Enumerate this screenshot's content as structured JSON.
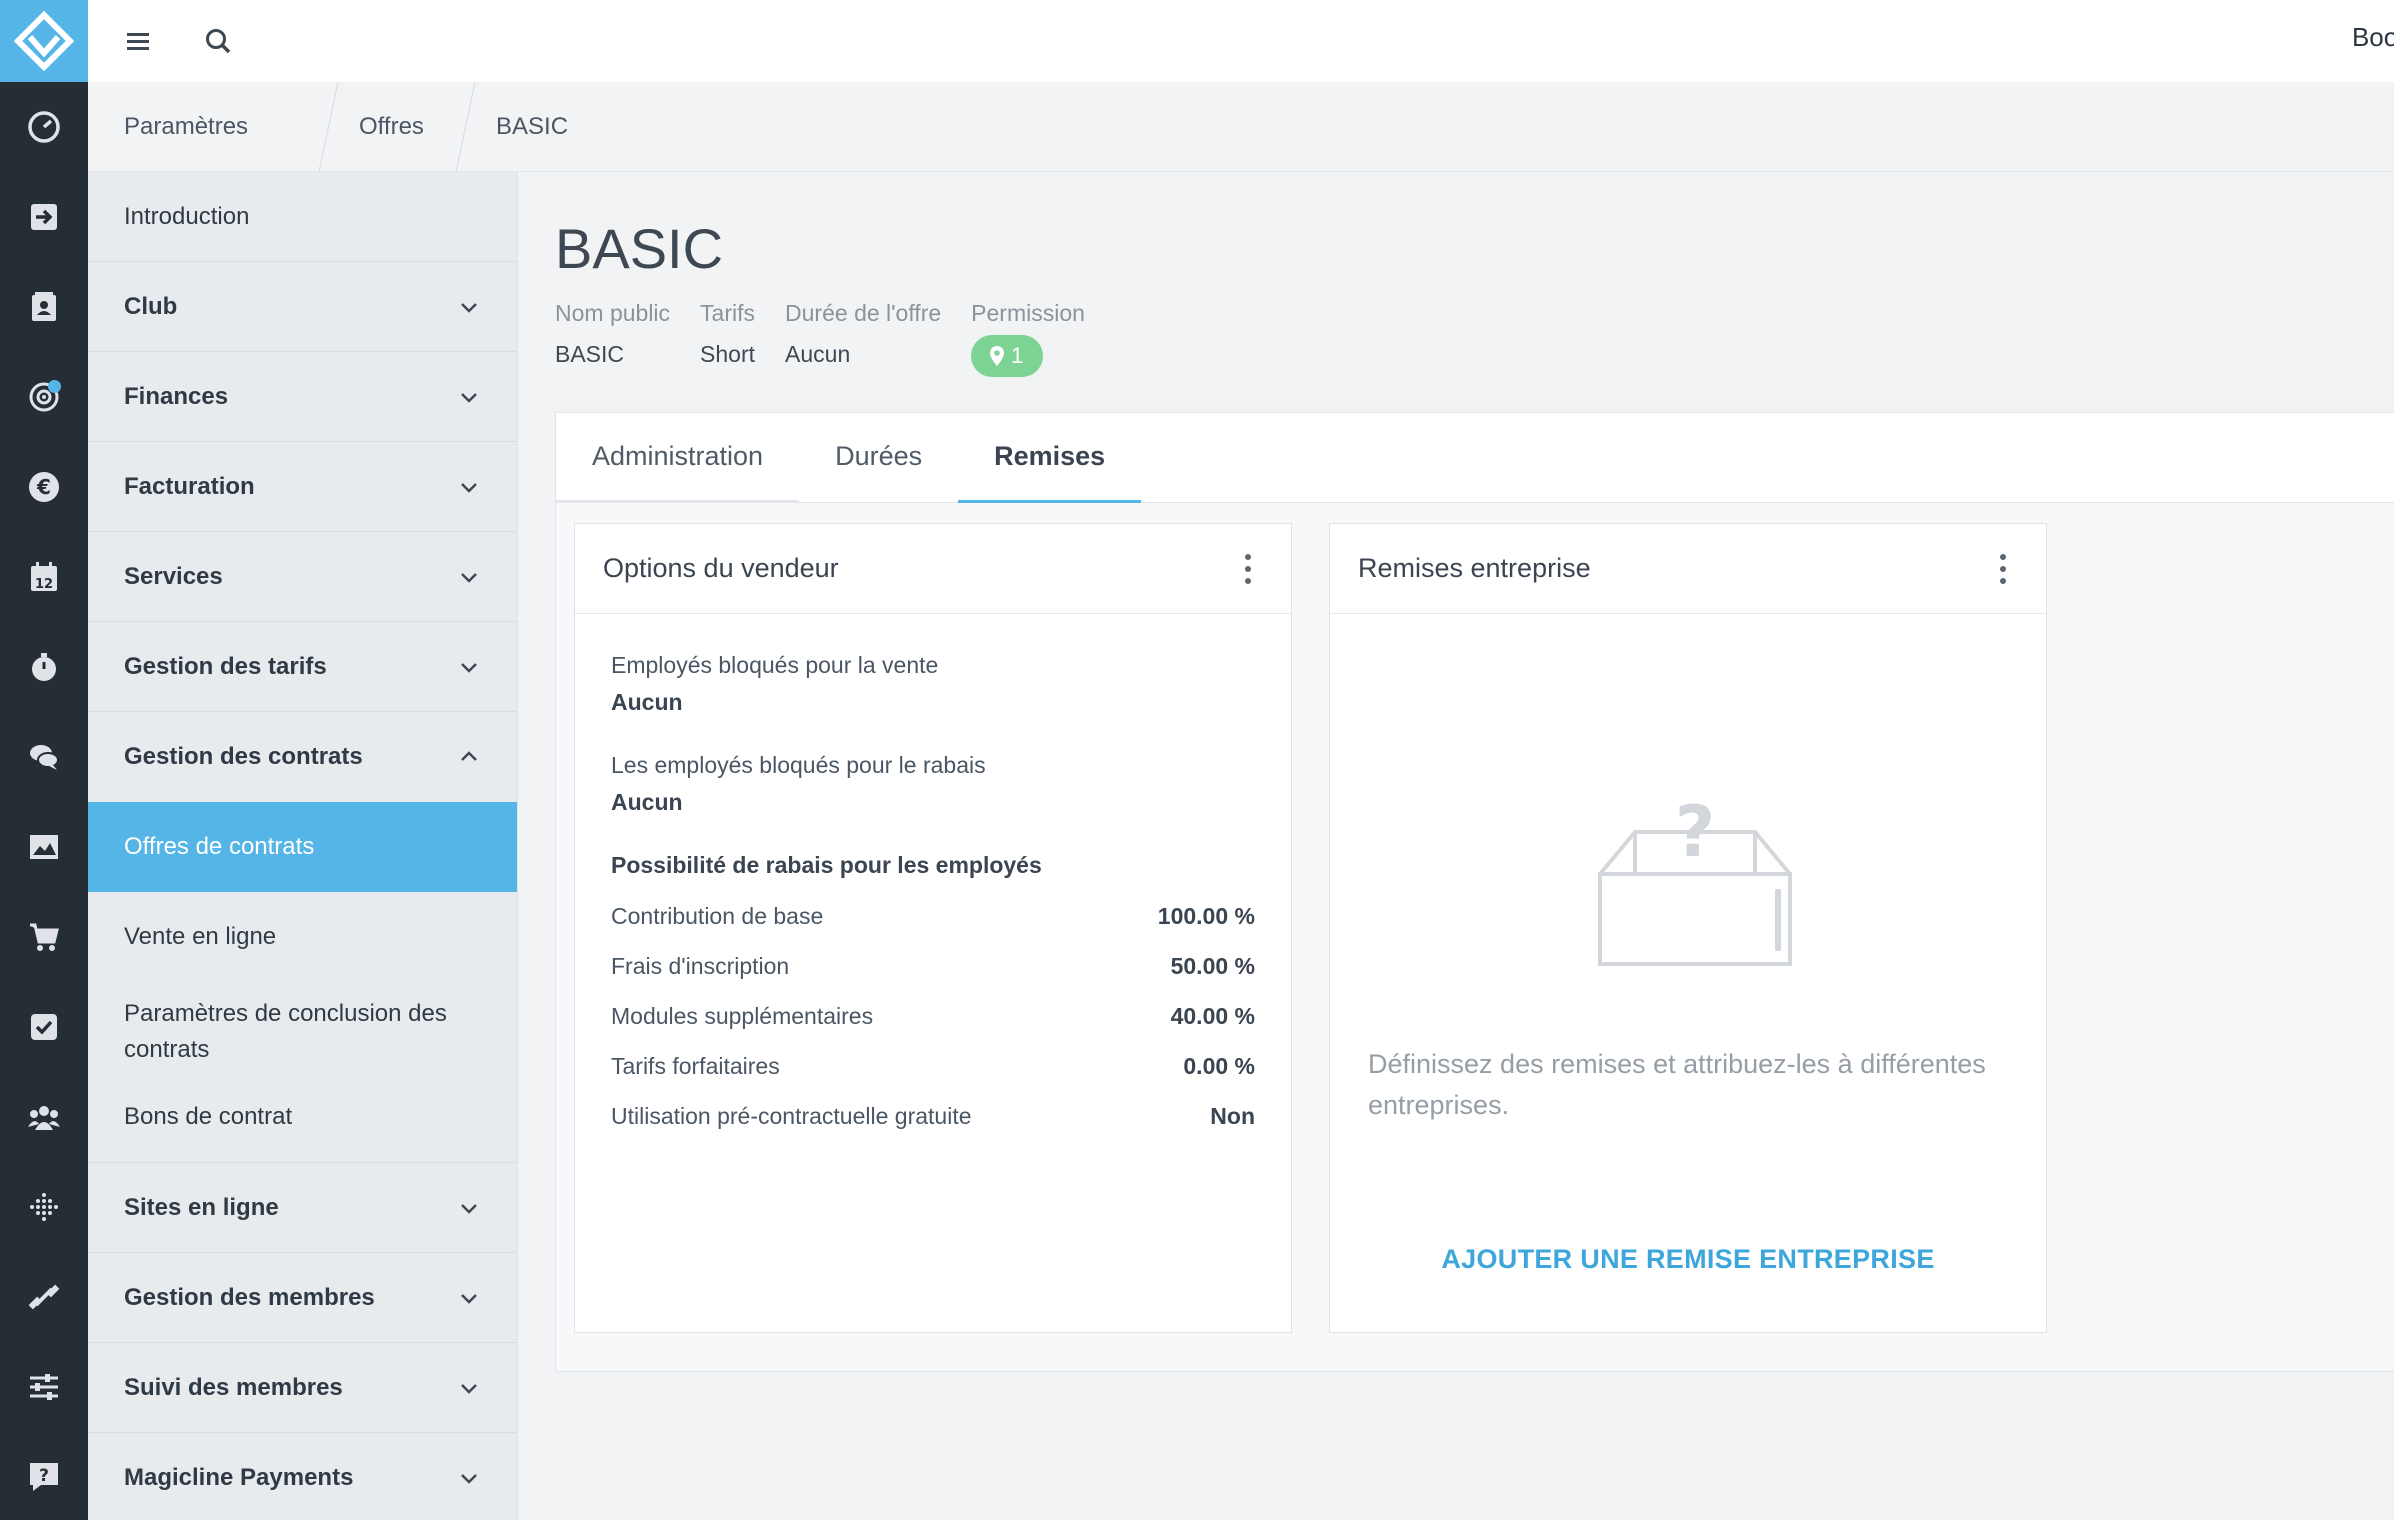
{
  "topbar": {
    "right_text": "Bool"
  },
  "breadcrumb": [
    "Paramètres",
    "Offres",
    "BASIC"
  ],
  "sidebar": {
    "items": [
      {
        "label": "Introduction"
      },
      {
        "label": "Club"
      },
      {
        "label": "Finances"
      },
      {
        "label": "Facturation"
      },
      {
        "label": "Services"
      },
      {
        "label": "Gestion des tarifs"
      },
      {
        "label": "Gestion des contrats"
      },
      {
        "label": "Sites en ligne"
      },
      {
        "label": "Gestion des membres"
      },
      {
        "label": "Suivi des membres"
      },
      {
        "label": "Magicline Payments"
      }
    ],
    "contracts_sub": [
      {
        "label": "Offres de contrats"
      },
      {
        "label": "Vente en ligne"
      },
      {
        "label": "Paramètres de conclusion des contrats"
      },
      {
        "label": "Bons de contrat"
      }
    ]
  },
  "page": {
    "title": "BASIC",
    "meta": [
      {
        "key": "Nom public",
        "value": "BASIC"
      },
      {
        "key": "Tarifs",
        "value": "Short"
      },
      {
        "key": "Durée de l'offre",
        "value": "Aucun"
      },
      {
        "key": "Permission",
        "value": "1"
      }
    ]
  },
  "tabs": [
    {
      "label": "Administration"
    },
    {
      "label": "Durées"
    },
    {
      "label": "Remises"
    }
  ],
  "vendor_card": {
    "title": "Options du vendeur",
    "fields": [
      {
        "key": "Employés bloqués pour la vente",
        "value": "Aucun"
      },
      {
        "key": "Les employés bloqués pour le rabais",
        "value": "Aucun"
      }
    ],
    "section_title": "Possibilité de rabais pour les employés",
    "rows": [
      {
        "label": "Contribution de base",
        "value": "100.00 %"
      },
      {
        "label": "Frais d'inscription",
        "value": "50.00 %"
      },
      {
        "label": "Modules supplémentaires",
        "value": "40.00 %"
      },
      {
        "label": "Tarifs forfaitaires",
        "value": "0.00 %"
      },
      {
        "label": "Utilisation pré-contractuelle gratuite",
        "value": "Non"
      }
    ]
  },
  "company_card": {
    "title": "Remises entreprise",
    "empty_text": "Définissez des remises et attribuez-les à différentes entreprises.",
    "add_label": "AJOUTER UNE REMISE ENTREPRISE"
  },
  "colors": {
    "accent": "#55b5e6",
    "rail": "#252d35",
    "badge": "#7dd394",
    "link": "#3fa6dc"
  }
}
